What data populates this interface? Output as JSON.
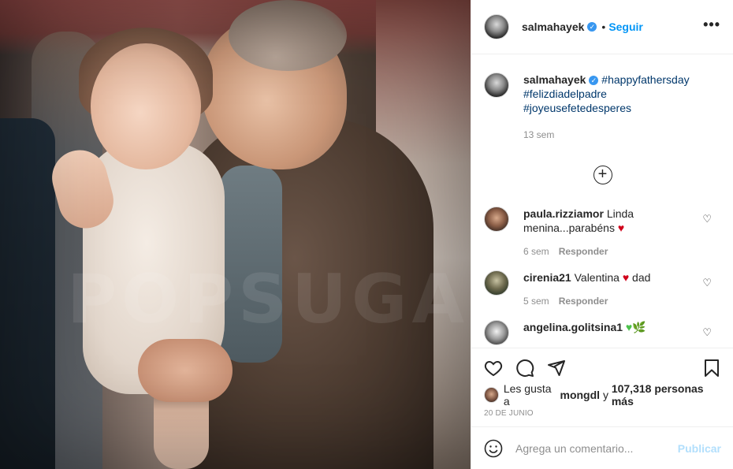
{
  "post": {
    "username": "salmahayek",
    "follow_label": "Seguir",
    "dot": "•",
    "more_label": "•••"
  },
  "caption": {
    "username": "salmahayek",
    "hashtags": [
      "#happyfathersday",
      "#felizdiadelpadre",
      "#joyeusefetedesperes"
    ],
    "age": "13 sem",
    "load_more_label": "+"
  },
  "comments": [
    {
      "username": "paula.rizziamor",
      "text": "Linda menina...parabéns",
      "emoji": "♥",
      "age": "6 sem",
      "reply_label": "Responder"
    },
    {
      "username": "cirenia21",
      "text": "Valentina",
      "emoji": "♥",
      "text_after": "dad",
      "age": "5 sem",
      "reply_label": "Responder"
    },
    {
      "username": "angelina.golitsina1",
      "text": "",
      "emoji": "♥",
      "emoji2": "🌿"
    }
  ],
  "likes": {
    "prefix": "Les gusta a",
    "user": "mongdl",
    "connector": "y",
    "count": "107,318 personas más"
  },
  "date": "20 DE JUNIO",
  "add_comment": {
    "placeholder": "Agrega un comentario...",
    "publish_label": "Publicar"
  },
  "photo": {
    "watermark": "POPSUGAR"
  },
  "colors": {
    "link": "#0095f6",
    "hashtag": "#00376b",
    "muted": "#8e8e8e",
    "heart": "#d0021b",
    "publish_disabled": "#b2dffc"
  },
  "icons": [
    "heart-icon",
    "comment-icon",
    "share-icon",
    "bookmark-icon",
    "emoji-icon",
    "more-icon",
    "add-icon",
    "verified-icon"
  ]
}
